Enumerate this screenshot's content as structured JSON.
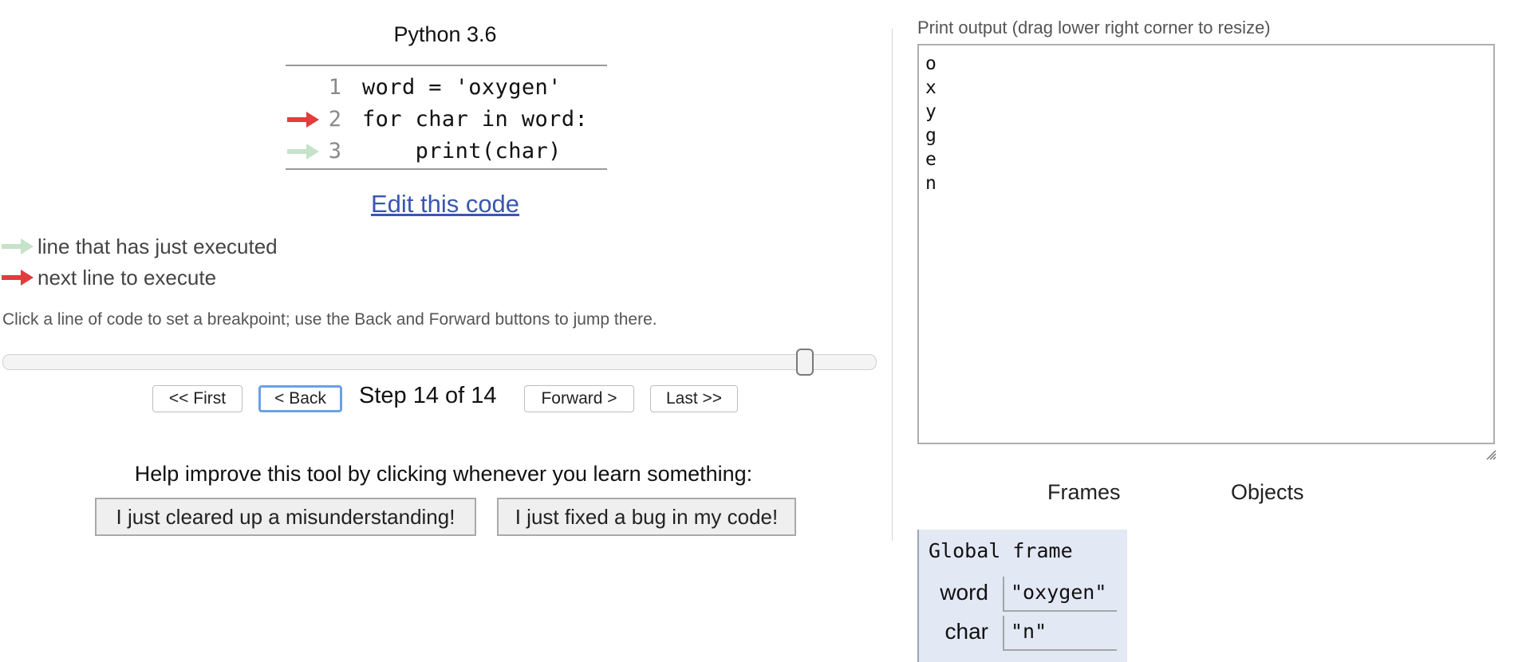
{
  "code_panel": {
    "language": "Python 3.6",
    "lines": [
      {
        "number": "1",
        "code": "word = 'oxygen'",
        "marker": "none"
      },
      {
        "number": "2",
        "code": "for char in word:",
        "marker": "next"
      },
      {
        "number": "3",
        "code": "    print(char)",
        "marker": "executed"
      }
    ],
    "edit_link": "Edit this code"
  },
  "legend": {
    "executed": "line that has just executed",
    "next": "next line to execute"
  },
  "hint": "Click a line of code to set a breakpoint; use the Back and Forward buttons to jump there.",
  "slider": {
    "position": 0.92
  },
  "navigation": {
    "first": "<< First",
    "back": "< Back",
    "step": "Step 14 of 14",
    "forward": "Forward >",
    "last": "Last >>"
  },
  "feedback": {
    "prompt": "Help improve this tool by clicking whenever you learn something:",
    "misunderstanding": "I just cleared up a misunderstanding!",
    "bug_fixed": "I just fixed a bug in my code!"
  },
  "output": {
    "label": "Print output (drag lower right corner to resize)",
    "lines": [
      "o",
      "x",
      "y",
      "g",
      "e",
      "n"
    ]
  },
  "visualization": {
    "frames_label": "Frames",
    "objects_label": "Objects",
    "global_frame": {
      "title": "Global frame",
      "variables": [
        {
          "name": "word",
          "value": "\"oxygen\""
        },
        {
          "name": "char",
          "value": "\"n\""
        }
      ]
    }
  },
  "colors": {
    "next_arrow": "#e23c3c",
    "executed_arrow": "#c6e2c9",
    "link": "#3a56b0",
    "frame_background": "#e2e8f4"
  }
}
